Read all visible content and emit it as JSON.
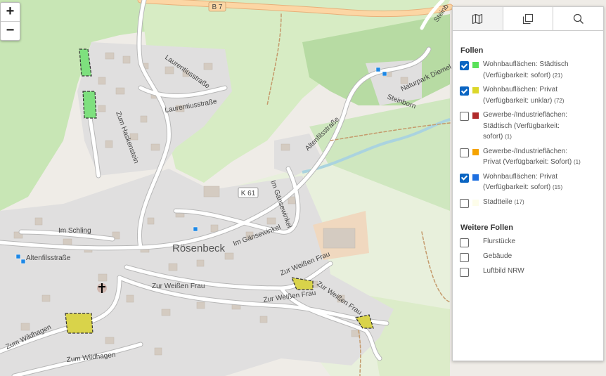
{
  "map": {
    "road_labels": [
      "B 7",
      "K 61",
      "Laurentiusstraße",
      "Laurentiusstraße",
      "Zum Haskenstein",
      "Altenfilsstraße",
      "Im Gänsewinkel",
      "Im Schling",
      "Altenfilsstraße",
      "Im Gänsewinkel",
      "Zur Weißen Frau",
      "Zur Weißen Frau",
      "Zur Weißen Frau",
      "Zur Weißen Frau",
      "Zum Wildhagen",
      "Zum Wildhagen",
      "Steinborn",
      "Naturpark Diemel",
      "Steinb"
    ],
    "place_label": "Rösenbeck"
  },
  "zoom": {
    "in": "+",
    "out": "−"
  },
  "panel": {
    "tabs": [
      {
        "icon": "map-icon",
        "active": true
      },
      {
        "icon": "layers-icon",
        "active": false
      },
      {
        "icon": "search-icon",
        "active": false
      }
    ],
    "section1_title": "Follen",
    "layers": [
      {
        "text": "Wohnbauflächen: Städtisch (Verfügbarkeit: sofort)",
        "count": "(21)",
        "checked": true,
        "color": "#59e159"
      },
      {
        "text": "Wohnbauflächen: Privat (Verfügbarkeit: unklar)",
        "count": "(72)",
        "checked": true,
        "color": "#dcd72a"
      },
      {
        "text": "Gewerbe-/Industrieflächen: Städtisch (Verfügbarkeit: sofort)",
        "count": "(1)",
        "checked": false,
        "color": "#b02a2a"
      },
      {
        "text": "Gewerbe-/Industrieflächen: Privat (Verfügbarkeit: Sofort)",
        "count": "(1)",
        "checked": false,
        "color": "#f5a300"
      },
      {
        "text": "Wohnbauflächen: Privat (Verfügbarkeit: sofort)",
        "count": "(15)",
        "checked": true,
        "color": "#1e6fe0"
      },
      {
        "text": "Stadtteile",
        "count": "(17)",
        "checked": false,
        "color": "#fdfdea"
      }
    ],
    "section2_title": "Weitere Follen",
    "more_layers": [
      {
        "text": "Flurstücke",
        "checked": false
      },
      {
        "text": "Gebäude",
        "checked": false
      },
      {
        "text": "Luftbild NRW",
        "checked": false
      }
    ]
  }
}
